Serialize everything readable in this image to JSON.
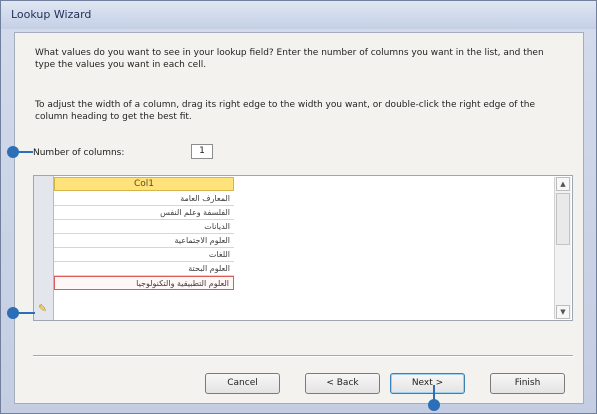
{
  "window": {
    "title": "Lookup Wizard"
  },
  "instructions": {
    "p1": "What values do you want to see in your lookup field? Enter the number of columns you want in the list, and then type the values you want in each cell.",
    "p2": "To adjust the width of a column, drag its right edge to the width you want, or double-click the right edge of the column heading to get the best fit."
  },
  "columns_field": {
    "label": "Number of columns:",
    "value": "1"
  },
  "grid": {
    "header": "Col1",
    "rows": [
      "المعارف العامة",
      "الفلسفة وعلم النفس",
      "الديانات",
      "العلوم الاجتماعية",
      "اللغات",
      "العلوم البحتة",
      "العلوم التطبيقية والتكنولوجيا"
    ]
  },
  "buttons": {
    "cancel": "Cancel",
    "back": "< Back",
    "next": "Next >",
    "finish": "Finish"
  }
}
